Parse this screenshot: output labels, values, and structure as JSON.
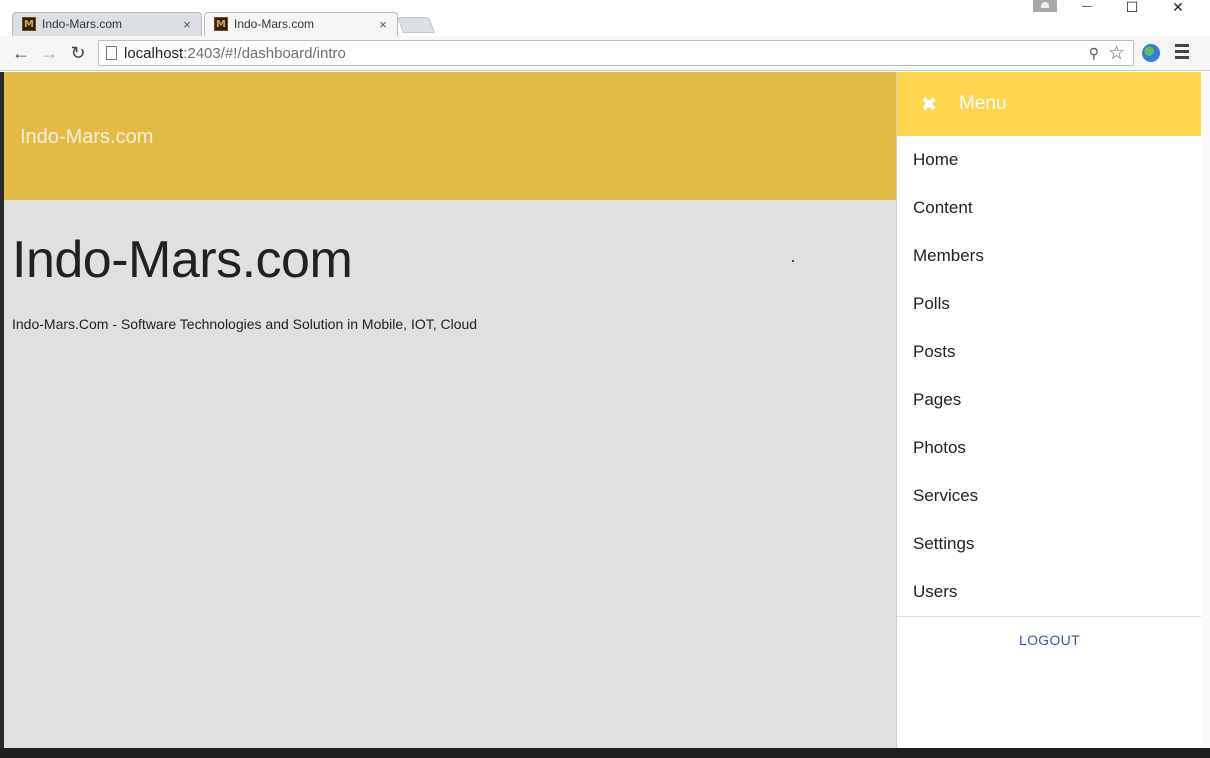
{
  "browser": {
    "tabs": [
      {
        "title": "Indo-Mars.com",
        "active": false
      },
      {
        "title": "Indo-Mars.com",
        "active": true
      }
    ],
    "tab_close_glyph": "×",
    "url_host": "localhost",
    "url_rest": ":2403/#!/dashboard/intro",
    "window_controls": {
      "minimize": "—",
      "maximize": "☐",
      "close": "✕"
    }
  },
  "app": {
    "header_title": "Indo-Mars.com",
    "hero_title": "Indo-Mars.com",
    "hero_subtitle": "Indo-Mars.Com - Software Technologies and Solution in Mobile, IOT, Cloud"
  },
  "sidemenu": {
    "title": "Menu",
    "items": [
      "Home",
      "Content",
      "Members",
      "Polls",
      "Posts",
      "Pages",
      "Photos",
      "Services",
      "Settings",
      "Users"
    ],
    "logout_label": "LOGOUT"
  },
  "colors": {
    "header_bg": "#e1bb45",
    "menu_header_bg": "#ffd54f",
    "page_bg": "#e0e0e0",
    "logout_text": "#3f51b5"
  },
  "icons": [
    "favicon-m-icon",
    "close-tab-icon",
    "back-arrow-icon",
    "forward-arrow-icon",
    "reload-icon",
    "page-icon",
    "key-icon",
    "star-icon",
    "extension-globe-icon",
    "hamburger-menu-icon",
    "close-icon"
  ]
}
